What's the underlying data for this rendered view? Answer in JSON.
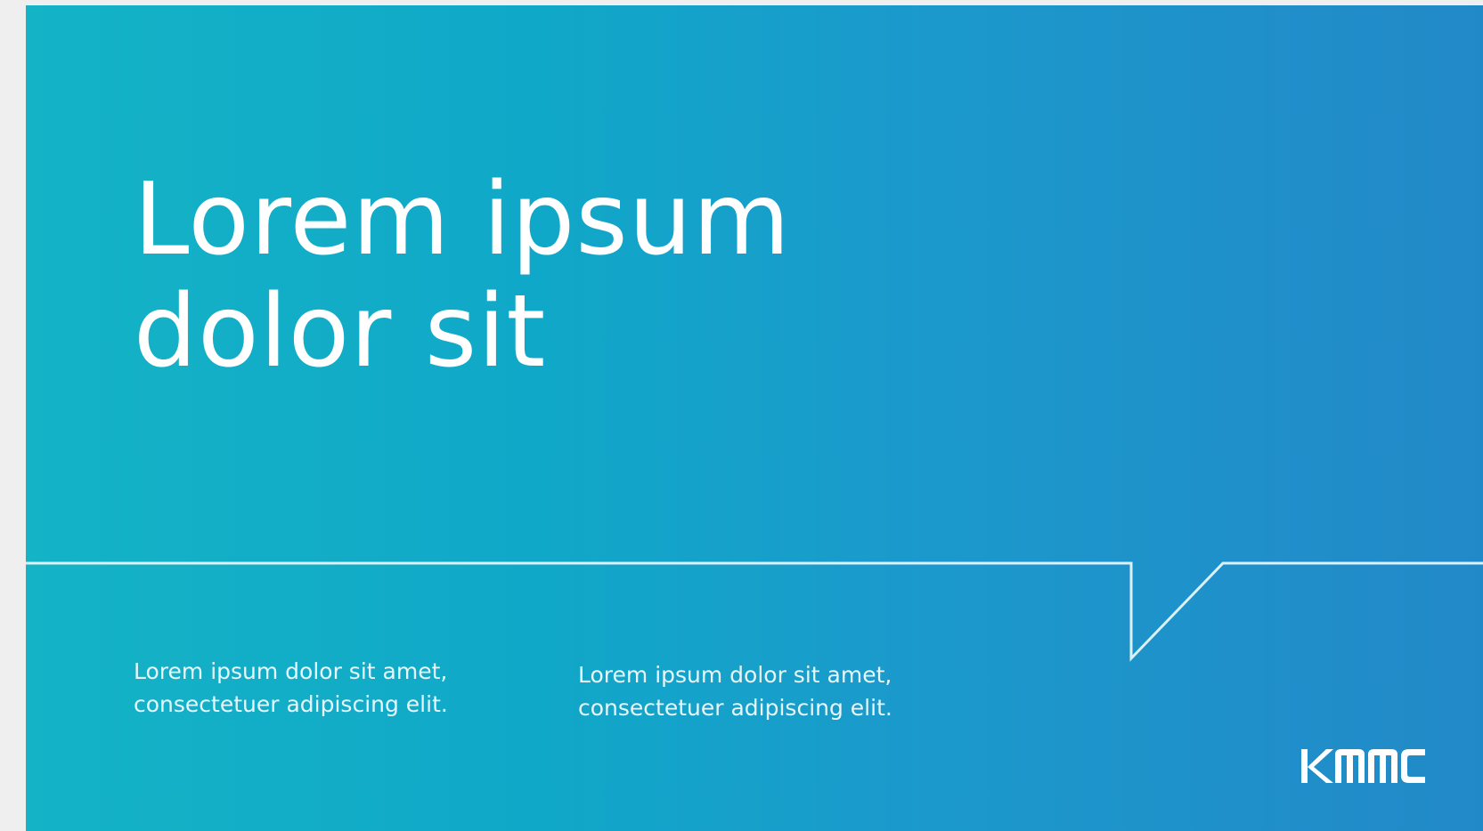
{
  "slide": {
    "title_lines": [
      "Lorem ipsum",
      "dolor sit"
    ],
    "column_1": {
      "lines": [
        "Lorem ipsum dolor sit amet,",
        "consectetuer adipiscing elit."
      ]
    },
    "column_2": {
      "lines": [
        "Lorem ipsum dolor sit amet,",
        "consectetuer adipiscing elit."
      ]
    },
    "logo_text": "KMMC"
  },
  "colors": {
    "gradient_start": "#14b3c6",
    "gradient_end": "#2289c8",
    "text": "#ffffff",
    "rule": "#cfe9f1"
  }
}
